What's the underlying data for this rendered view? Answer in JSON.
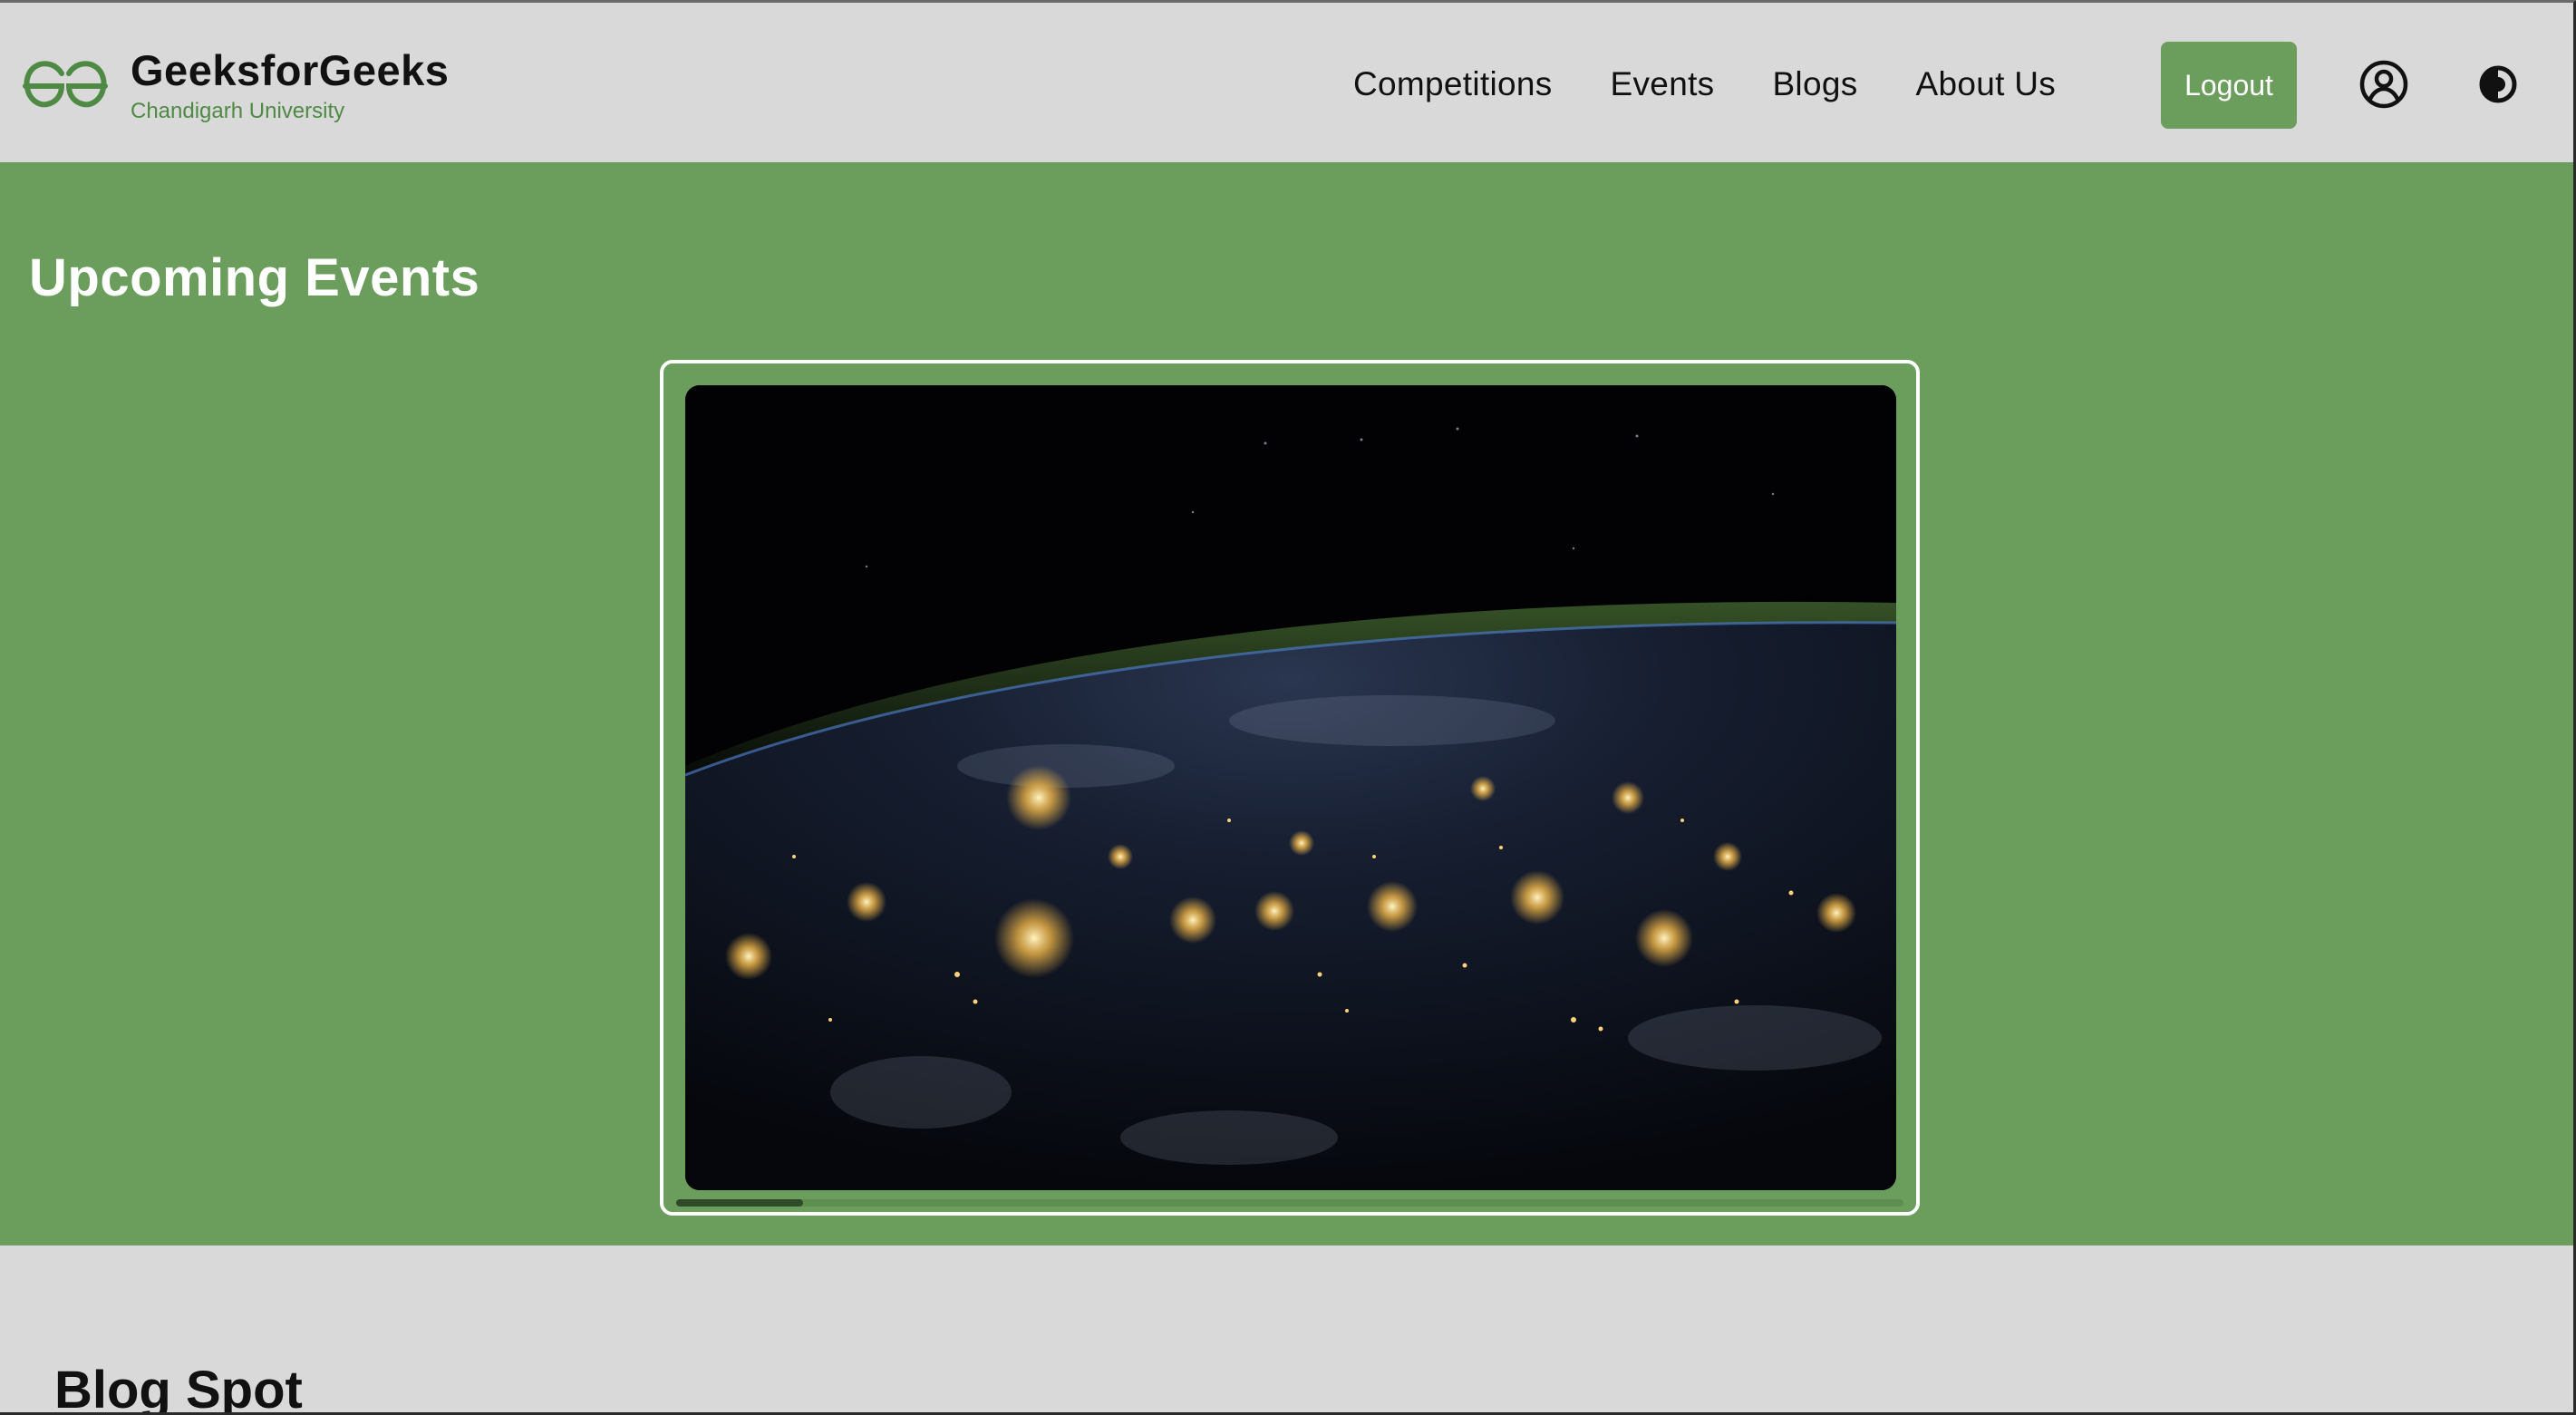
{
  "header": {
    "brand_name": "GeeksforGeeks",
    "brand_sub": "Chandigarh University",
    "nav": [
      {
        "label": "Competitions"
      },
      {
        "label": "Events"
      },
      {
        "label": "Blogs"
      },
      {
        "label": "About Us"
      }
    ],
    "logout_label": "Logout",
    "icons": {
      "logo": "gfg-logo-icon",
      "user": "user-circle-icon",
      "theme": "contrast-theme-icon"
    },
    "colors": {
      "accent": "#6b9e5c",
      "brand_sub": "#4f8a45"
    }
  },
  "events": {
    "title": "Upcoming Events",
    "slide_image": "earth-at-night-from-space",
    "colors": {
      "background": "#6b9e5c"
    }
  },
  "blog": {
    "title": "Blog Spot"
  }
}
